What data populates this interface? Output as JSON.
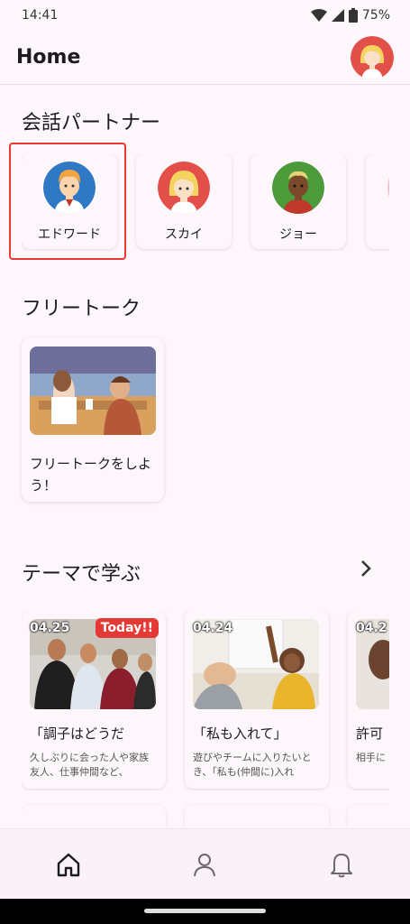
{
  "status_bar": {
    "time": "14:41",
    "battery": "75%"
  },
  "app_bar": {
    "title": "Home",
    "avatar_icon": "user-avatar-female-icon"
  },
  "partners": {
    "title": "会話パートナー",
    "items": [
      {
        "name": "エドワード",
        "icon": "edward-avatar-icon",
        "selected": true
      },
      {
        "name": "スカイ",
        "icon": "sky-avatar-icon",
        "selected": false
      },
      {
        "name": "ジョー",
        "icon": "joe-avatar-icon",
        "selected": false
      }
    ],
    "selected_outline_color": "#e53935"
  },
  "free_talk": {
    "title": "フリートーク",
    "card_label": "フリートークをしよう！"
  },
  "themes": {
    "title": "テーマで学ぶ",
    "items": [
      {
        "date": "04.25",
        "badge": "Today!!",
        "title": "「調子はどうだ",
        "desc": "久しぶりに会った人や家族友人、仕事仲間など、"
      },
      {
        "date": "04.24",
        "badge": "",
        "title": "「私も入れて」",
        "desc": "遊びやチームに入りたいとき、「私も(仲間に)入れ"
      },
      {
        "date": "04.2",
        "badge": "",
        "title": "許可",
        "desc": "相手に は、“("
      }
    ]
  },
  "bottom_nav": {
    "items": [
      {
        "icon": "home-icon",
        "active": true
      },
      {
        "icon": "profile-icon",
        "active": false
      },
      {
        "icon": "bell-icon",
        "active": false
      }
    ]
  },
  "colors": {
    "background": "#fdf6fb",
    "accent_red": "#e53935"
  }
}
